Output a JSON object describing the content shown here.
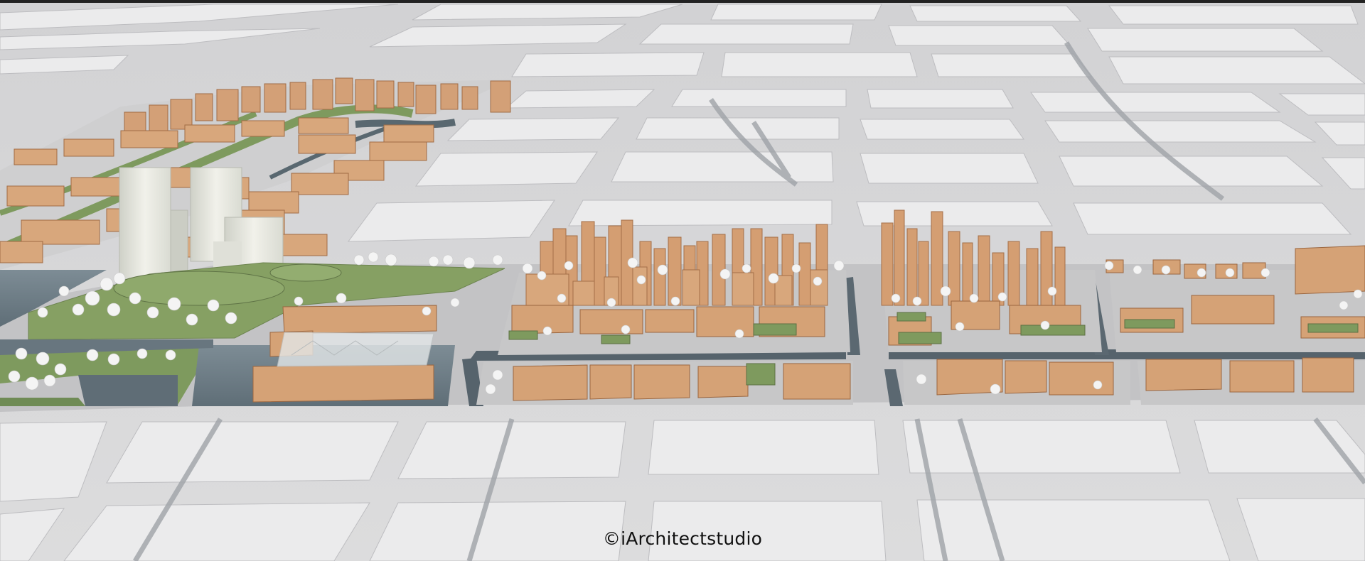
{
  "credit": "©iArchitectstudio",
  "colors": {
    "block": "#e9e9ea",
    "road": "#c9c9cb",
    "water": "#6d7c86",
    "canal": "#55636c",
    "grass": "#7e9a5e",
    "building_top": "#d9a679",
    "building_front": "#c88f5d",
    "building_side": "#a8724a",
    "tower_glass": "#e8e8e1",
    "tree": "#f2f2f2"
  }
}
